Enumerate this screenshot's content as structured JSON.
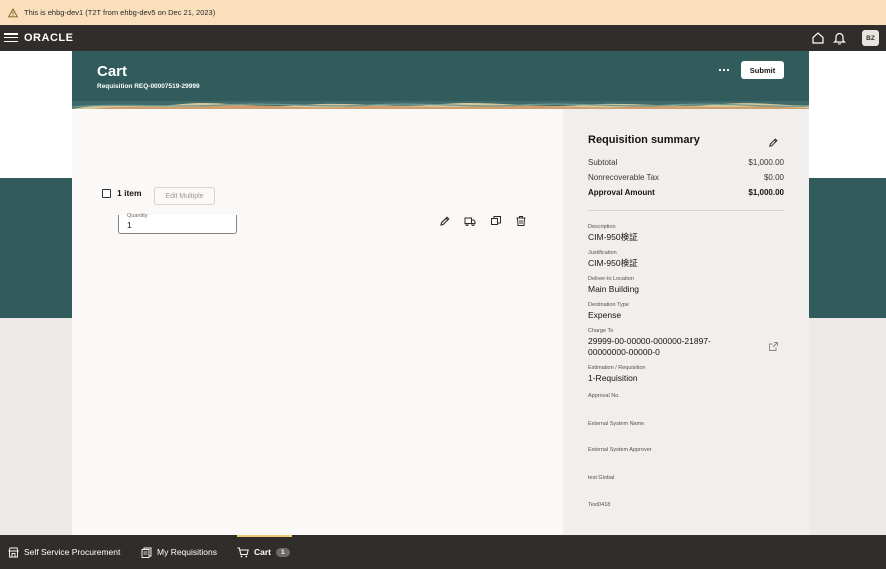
{
  "banner": {
    "text": "This is ehbg-dev1 (T2T from ehbg-dev5 on Dec 21, 2023)"
  },
  "topbar": {
    "logo": "ORACLE",
    "avatar_initials": "BZ"
  },
  "header": {
    "title": "Cart",
    "subtitle": "Requisition REQ-00007519-29999",
    "submit_label": "Submit"
  },
  "cart": {
    "item_count": "1 item",
    "edit_multiple": "Edit Multiple",
    "line": {
      "quantity_label": "Quantity",
      "quantity_value": "1"
    }
  },
  "summary": {
    "title": "Requisition summary",
    "rows": [
      {
        "label": "Subtotal",
        "value": "$1,000.00"
      },
      {
        "label": "Nonrecoverable Tax",
        "value": "$0.00"
      },
      {
        "label": "Approval Amount",
        "value": "$1,000.00"
      }
    ],
    "fields": [
      {
        "label": "Description",
        "value": "CIM-950検証"
      },
      {
        "label": "Justification",
        "value": "CIM-950検証"
      },
      {
        "label": "Deliver-to Location",
        "value": "Main Building"
      },
      {
        "label": "Destination Type",
        "value": "Expense"
      },
      {
        "label": "Charge To",
        "value": "29999-00-00000-000000-21897-",
        "value2": "00000000-00000-0"
      },
      {
        "label": "Estimation / Requisition",
        "value": "1-Requisition"
      },
      {
        "label": "Approval No.",
        "value": ""
      },
      {
        "label": "External System Name",
        "value": ""
      },
      {
        "label": "External System Approver",
        "value": ""
      },
      {
        "label": "test Global",
        "value": ""
      },
      {
        "label": "Test0418",
        "value": ""
      }
    ]
  },
  "bottomnav": {
    "items": [
      {
        "label": "Self Service Procurement"
      },
      {
        "label": "My Requisitions"
      },
      {
        "label": "Cart",
        "badge": "1"
      }
    ]
  },
  "colors": {
    "brand_teal": "#325b5c",
    "banner": "#fadfbd",
    "chrome": "#312d2a",
    "active_accent": "#f0cc71"
  }
}
